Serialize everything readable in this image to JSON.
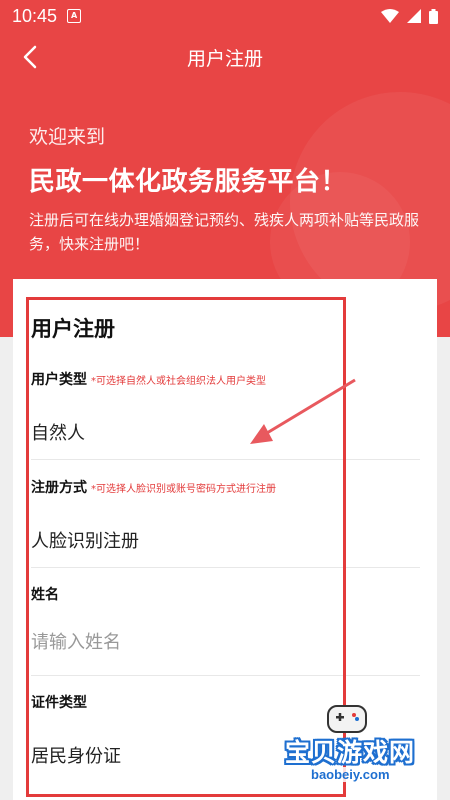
{
  "status_bar": {
    "time": "10:45",
    "notification_icon_letter": "A",
    "icons": [
      "wifi-icon",
      "signal-icon",
      "battery-icon"
    ]
  },
  "header": {
    "title": "用户注册",
    "welcome": "欢迎来到",
    "headline": "民政一体化政务服务平台！",
    "description": "注册后可在线办理婚姻登记预约、残疾人两项补贴等民政服务，快来注册吧！"
  },
  "form": {
    "title": "用户注册",
    "fields": [
      {
        "label": "用户类型",
        "hint": "*可选择自然人或社会组织法人用户类型",
        "value": "自然人"
      },
      {
        "label": "注册方式",
        "hint": "*可选择人脸识别或账号密码方式进行注册",
        "value": "人脸识别注册"
      },
      {
        "label": "姓名",
        "hint": "",
        "placeholder": "请输入姓名"
      },
      {
        "label": "证件类型",
        "hint": "",
        "value": "居民身份证"
      }
    ]
  },
  "watermark": {
    "text": "宝贝游戏网",
    "url": "baobeiy.com"
  },
  "colors": {
    "brand_red": "#e84545",
    "annotation_red": "#e33b3b"
  }
}
